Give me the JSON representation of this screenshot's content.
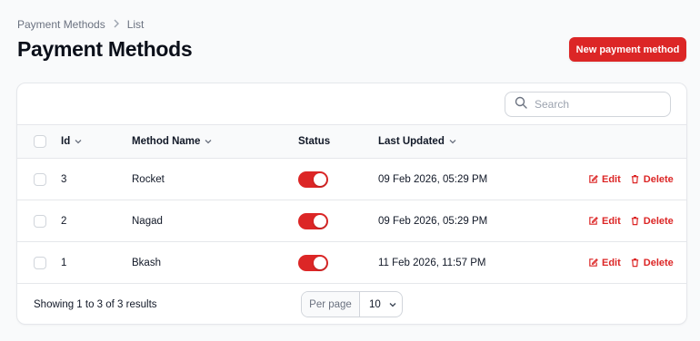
{
  "breadcrumb": {
    "items": [
      "Payment Methods",
      "List"
    ]
  },
  "page": {
    "title": "Payment Methods",
    "new_button": "New payment method"
  },
  "search": {
    "placeholder": "Search",
    "value": ""
  },
  "table": {
    "columns": {
      "id": "Id",
      "method_name": "Method Name",
      "status": "Status",
      "last_updated": "Last Updated"
    },
    "rows": [
      {
        "id": "3",
        "method_name": "Rocket",
        "status": true,
        "last_updated": "09 Feb 2026, 05:29 PM",
        "edit": "Edit",
        "delete": "Delete"
      },
      {
        "id": "2",
        "method_name": "Nagad",
        "status": true,
        "last_updated": "09 Feb 2026, 05:29 PM",
        "edit": "Edit",
        "delete": "Delete"
      },
      {
        "id": "1",
        "method_name": "Bkash",
        "status": true,
        "last_updated": "11 Feb 2026, 11:57 PM",
        "edit": "Edit",
        "delete": "Delete"
      }
    ]
  },
  "footer": {
    "summary": "Showing 1 to 3 of 3 results",
    "per_page_label": "Per page",
    "per_page_value": "10"
  },
  "colors": {
    "accent": "#dc2626"
  },
  "icons": [
    "chevron-right-icon",
    "search-icon",
    "chevron-down-icon",
    "edit-icon",
    "trash-icon"
  ]
}
